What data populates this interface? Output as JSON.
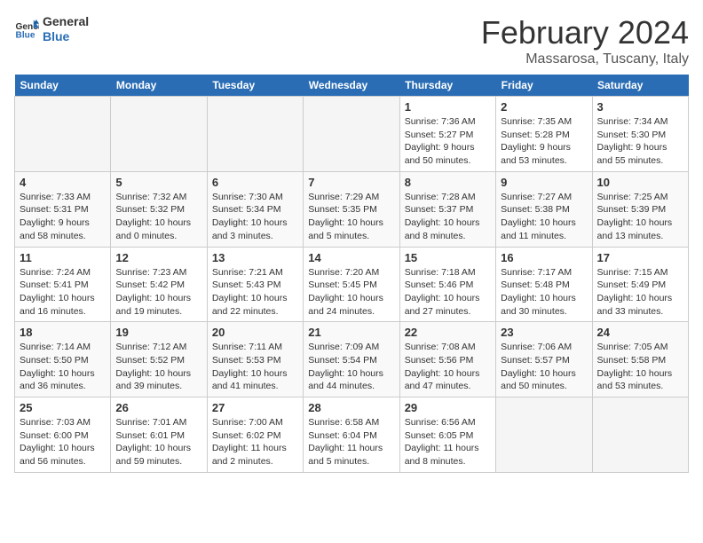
{
  "header": {
    "logo_line1": "General",
    "logo_line2": "Blue",
    "title": "February 2024",
    "subtitle": "Massarosa, Tuscany, Italy"
  },
  "weekdays": [
    "Sunday",
    "Monday",
    "Tuesday",
    "Wednesday",
    "Thursday",
    "Friday",
    "Saturday"
  ],
  "weeks": [
    [
      {
        "day": "",
        "empty": true
      },
      {
        "day": "",
        "empty": true
      },
      {
        "day": "",
        "empty": true
      },
      {
        "day": "",
        "empty": true
      },
      {
        "day": "1",
        "sunrise": "7:36 AM",
        "sunset": "5:27 PM",
        "daylight": "9 hours and 50 minutes."
      },
      {
        "day": "2",
        "sunrise": "7:35 AM",
        "sunset": "5:28 PM",
        "daylight": "9 hours and 53 minutes."
      },
      {
        "day": "3",
        "sunrise": "7:34 AM",
        "sunset": "5:30 PM",
        "daylight": "9 hours and 55 minutes."
      }
    ],
    [
      {
        "day": "4",
        "sunrise": "7:33 AM",
        "sunset": "5:31 PM",
        "daylight": "9 hours and 58 minutes."
      },
      {
        "day": "5",
        "sunrise": "7:32 AM",
        "sunset": "5:32 PM",
        "daylight": "10 hours and 0 minutes."
      },
      {
        "day": "6",
        "sunrise": "7:30 AM",
        "sunset": "5:34 PM",
        "daylight": "10 hours and 3 minutes."
      },
      {
        "day": "7",
        "sunrise": "7:29 AM",
        "sunset": "5:35 PM",
        "daylight": "10 hours and 5 minutes."
      },
      {
        "day": "8",
        "sunrise": "7:28 AM",
        "sunset": "5:37 PM",
        "daylight": "10 hours and 8 minutes."
      },
      {
        "day": "9",
        "sunrise": "7:27 AM",
        "sunset": "5:38 PM",
        "daylight": "10 hours and 11 minutes."
      },
      {
        "day": "10",
        "sunrise": "7:25 AM",
        "sunset": "5:39 PM",
        "daylight": "10 hours and 13 minutes."
      }
    ],
    [
      {
        "day": "11",
        "sunrise": "7:24 AM",
        "sunset": "5:41 PM",
        "daylight": "10 hours and 16 minutes."
      },
      {
        "day": "12",
        "sunrise": "7:23 AM",
        "sunset": "5:42 PM",
        "daylight": "10 hours and 19 minutes."
      },
      {
        "day": "13",
        "sunrise": "7:21 AM",
        "sunset": "5:43 PM",
        "daylight": "10 hours and 22 minutes."
      },
      {
        "day": "14",
        "sunrise": "7:20 AM",
        "sunset": "5:45 PM",
        "daylight": "10 hours and 24 minutes."
      },
      {
        "day": "15",
        "sunrise": "7:18 AM",
        "sunset": "5:46 PM",
        "daylight": "10 hours and 27 minutes."
      },
      {
        "day": "16",
        "sunrise": "7:17 AM",
        "sunset": "5:48 PM",
        "daylight": "10 hours and 30 minutes."
      },
      {
        "day": "17",
        "sunrise": "7:15 AM",
        "sunset": "5:49 PM",
        "daylight": "10 hours and 33 minutes."
      }
    ],
    [
      {
        "day": "18",
        "sunrise": "7:14 AM",
        "sunset": "5:50 PM",
        "daylight": "10 hours and 36 minutes."
      },
      {
        "day": "19",
        "sunrise": "7:12 AM",
        "sunset": "5:52 PM",
        "daylight": "10 hours and 39 minutes."
      },
      {
        "day": "20",
        "sunrise": "7:11 AM",
        "sunset": "5:53 PM",
        "daylight": "10 hours and 41 minutes."
      },
      {
        "day": "21",
        "sunrise": "7:09 AM",
        "sunset": "5:54 PM",
        "daylight": "10 hours and 44 minutes."
      },
      {
        "day": "22",
        "sunrise": "7:08 AM",
        "sunset": "5:56 PM",
        "daylight": "10 hours and 47 minutes."
      },
      {
        "day": "23",
        "sunrise": "7:06 AM",
        "sunset": "5:57 PM",
        "daylight": "10 hours and 50 minutes."
      },
      {
        "day": "24",
        "sunrise": "7:05 AM",
        "sunset": "5:58 PM",
        "daylight": "10 hours and 53 minutes."
      }
    ],
    [
      {
        "day": "25",
        "sunrise": "7:03 AM",
        "sunset": "6:00 PM",
        "daylight": "10 hours and 56 minutes."
      },
      {
        "day": "26",
        "sunrise": "7:01 AM",
        "sunset": "6:01 PM",
        "daylight": "10 hours and 59 minutes."
      },
      {
        "day": "27",
        "sunrise": "7:00 AM",
        "sunset": "6:02 PM",
        "daylight": "11 hours and 2 minutes."
      },
      {
        "day": "28",
        "sunrise": "6:58 AM",
        "sunset": "6:04 PM",
        "daylight": "11 hours and 5 minutes."
      },
      {
        "day": "29",
        "sunrise": "6:56 AM",
        "sunset": "6:05 PM",
        "daylight": "11 hours and 8 minutes."
      },
      {
        "day": "",
        "empty": true
      },
      {
        "day": "",
        "empty": true
      }
    ]
  ],
  "labels": {
    "sunrise_prefix": "Sunrise: ",
    "sunset_prefix": "Sunset: ",
    "daylight_prefix": "Daylight: "
  }
}
